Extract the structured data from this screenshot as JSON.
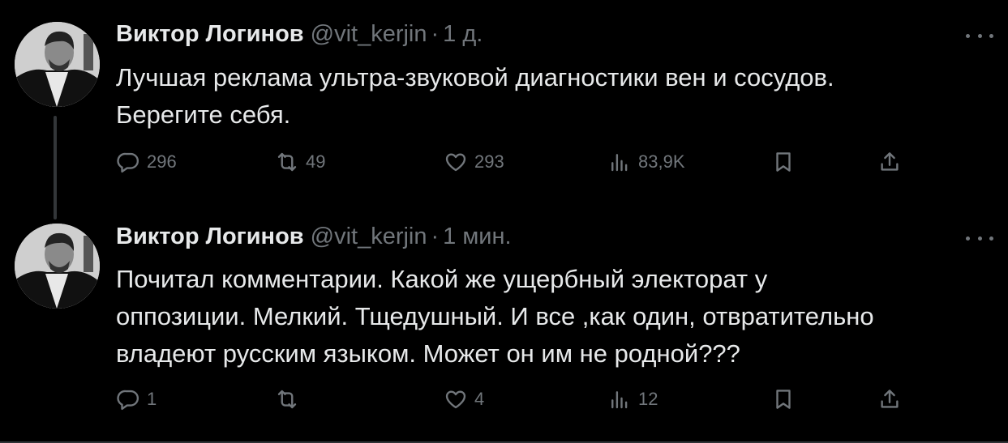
{
  "tweets": [
    {
      "author": {
        "name": "Виктор Логинов",
        "handle": "@vit_kerjin"
      },
      "time": "1 д.",
      "text_lines": [
        "Лучшая реклама ультра-звуковой диагностики вен и сосудов.",
        "Берегите себя."
      ],
      "stats": {
        "replies": "296",
        "retweets": "49",
        "likes": "293",
        "views": "83,9K"
      }
    },
    {
      "author": {
        "name": "Виктор Логинов",
        "handle": "@vit_kerjin"
      },
      "time": "1 мин.",
      "text_lines": [
        "Почитал комментарии. Какой же ущербный электорат у",
        "оппозиции. Мелкий. Тщедушный. И все ,как один, отвратительно",
        "владеют русским языком. Может он им не родной???"
      ],
      "stats": {
        "replies": "1",
        "retweets": "",
        "likes": "4",
        "views": "12"
      }
    }
  ],
  "separator_dot": "·",
  "icons": {
    "reply": "reply-icon",
    "retweet": "retweet-icon",
    "like": "heart-icon",
    "views": "views-icon",
    "bookmark": "bookmark-icon",
    "share": "share-icon",
    "more": "more-icon"
  },
  "colors": {
    "background": "#000000",
    "text": "#e7e9ea",
    "muted": "#71767b"
  }
}
